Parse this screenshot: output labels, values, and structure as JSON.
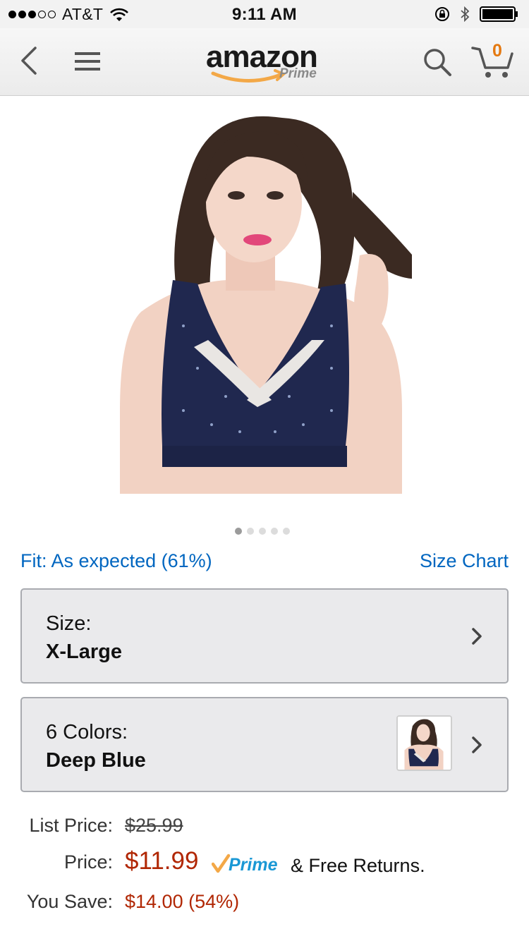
{
  "status_bar": {
    "carrier": "AT&T",
    "time": "9:11 AM",
    "signal_filled": 3,
    "signal_total": 5
  },
  "header": {
    "logo_text": "amazon",
    "logo_sub": "Prime",
    "cart_count": "0",
    "colors": {
      "brand_orange": "#e47911",
      "icon_gray": "#555555"
    }
  },
  "gallery": {
    "image_count": 5,
    "active_index": 0
  },
  "fit": {
    "text": "Fit: As expected (61%)",
    "size_chart": "Size Chart"
  },
  "size_selector": {
    "label": "Size:",
    "value": "X-Large"
  },
  "color_selector": {
    "label": "6 Colors:",
    "value": "Deep Blue"
  },
  "price": {
    "list_label": "List Price:",
    "list_value": "$25.99",
    "price_label": "Price:",
    "price_value": "$11.99",
    "prime_text": "Prime",
    "free_returns": "& Free Returns.",
    "save_label": "You Save:",
    "save_value": "$14.00 (54%)",
    "colors": {
      "price_red": "#b12704",
      "link_blue": "#0066c0"
    }
  }
}
